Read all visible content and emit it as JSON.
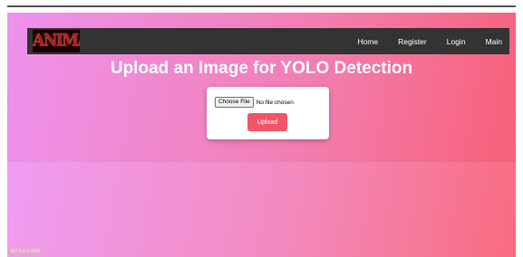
{
  "navbar": {
    "logo_text": "ANIMAL PARK",
    "links": [
      {
        "label": "Home"
      },
      {
        "label": "Register"
      },
      {
        "label": "Login"
      },
      {
        "label": "Main"
      }
    ]
  },
  "main": {
    "title": "Upload an Image for YOLO Detection",
    "file_input": {
      "button_label": "Choose File",
      "status": "No file chosen"
    },
    "upload_button_label": "Upload"
  },
  "footer": {
    "corner_label": "127.0.0.1:5000"
  },
  "colors": {
    "gradient_start": "#ee92ee",
    "gradient_end": "#f85e74",
    "navbar_bg": "#333333",
    "upload_button": "#f0566a"
  }
}
